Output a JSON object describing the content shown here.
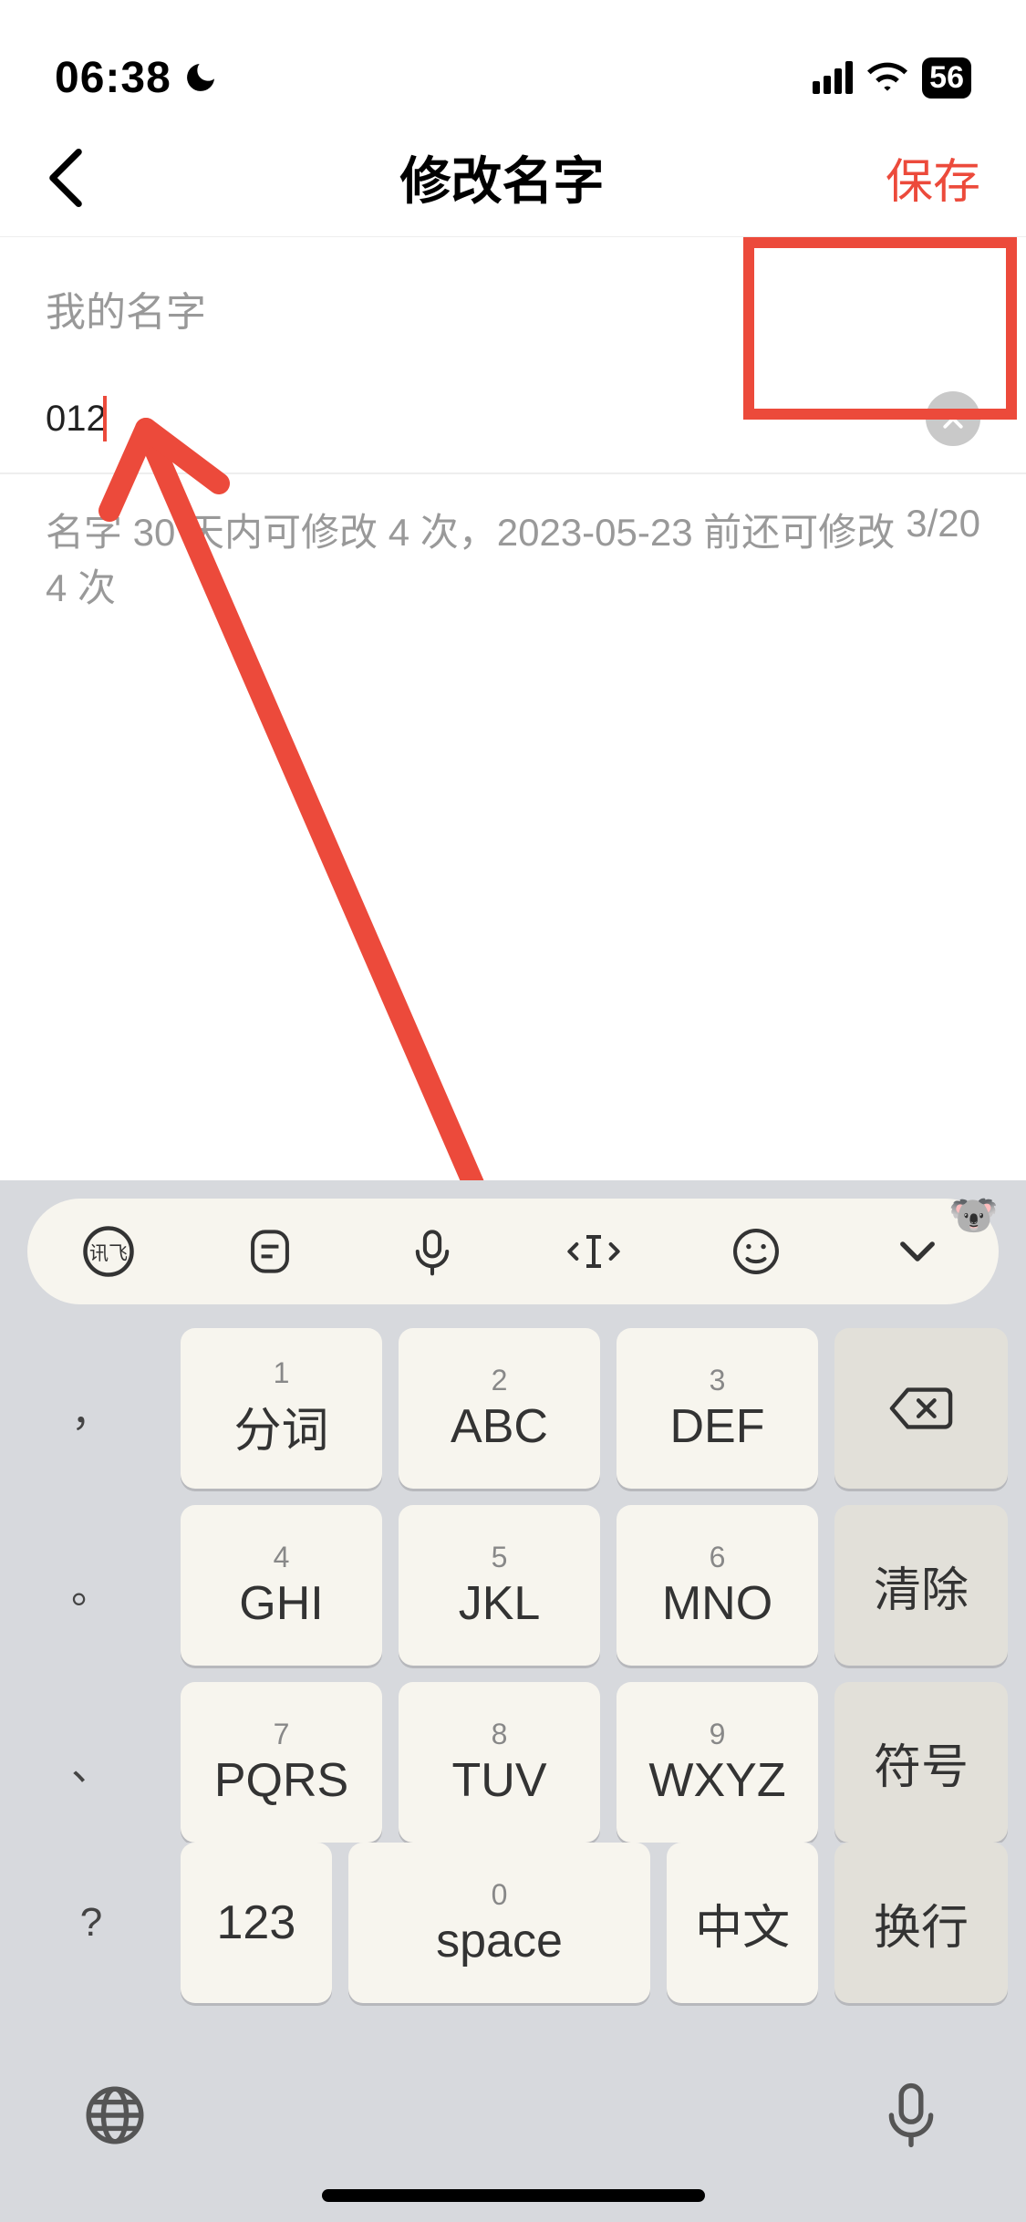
{
  "status": {
    "time": "06:38",
    "battery": "56"
  },
  "nav": {
    "title": "修改名字",
    "save": "保存"
  },
  "form": {
    "section_label": "我的名字",
    "value": "012",
    "hint": "名字 30 天内可修改 4 次，2023-05-23 前还可修改 4 次",
    "counter": "3/20"
  },
  "keyboard": {
    "toolbar_logo": "讯飞",
    "rows": [
      {
        "left": "，",
        "k1n": "1",
        "k1": "分词",
        "k2n": "2",
        "k2": "ABC",
        "k3n": "3",
        "k3": "DEF",
        "right": ""
      },
      {
        "left": "。",
        "k1n": "4",
        "k1": "GHI",
        "k2n": "5",
        "k2": "JKL",
        "k3n": "6",
        "k3": "MNO",
        "right": "清除"
      },
      {
        "left": "、",
        "k1n": "7",
        "k1": "PQRS",
        "k2n": "8",
        "k2": "TUV",
        "k3n": "9",
        "k3": "WXYZ",
        "right": "符号"
      },
      {
        "left": "："
      }
    ],
    "bottom": {
      "q": "?",
      "num": "123",
      "space_n": "0",
      "space": "space",
      "cn": "中文",
      "enter": "换行"
    }
  }
}
